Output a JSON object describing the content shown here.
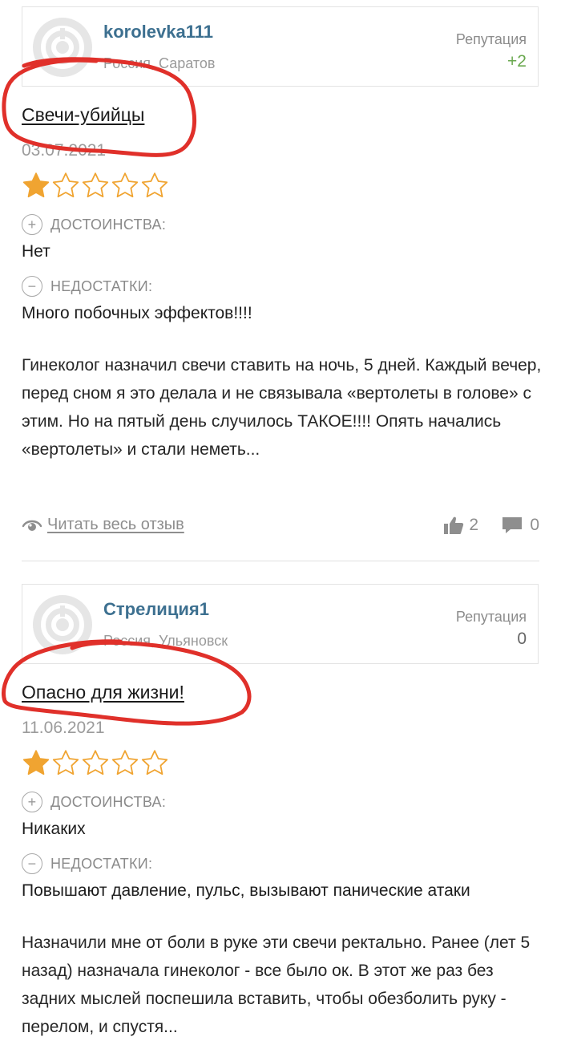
{
  "reviews": [
    {
      "author": {
        "name": "korolevka111",
        "location": "Россия, Саратов"
      },
      "reputation": {
        "label": "Репутация",
        "value": "+2",
        "color": "#6aa84f"
      },
      "title": "Свечи-убийцы",
      "date": "03.07.2021",
      "rating": 1,
      "pros": {
        "label": "ДОСТОИНСТВА:",
        "text": "Нет"
      },
      "cons": {
        "label": "НЕДОСТАТКИ:",
        "text": "Много побочных эффектов!!!!"
      },
      "body": "Гинеколог назначил свечи ставить на ночь, 5 дней. Каждый вечер, перед сном я это делала и не связывала «вертолеты в голове» с этим. Но на пятый день случилось ТАКОЕ!!!! Опять начались «вертолеты» и стали неметь...",
      "read_more": "Читать весь отзыв",
      "likes": "2",
      "comments": "0"
    },
    {
      "author": {
        "name": "Стрелиция1",
        "location": "Россия, Ульяновск"
      },
      "reputation": {
        "label": "Репутация",
        "value": "0",
        "color": "#666666"
      },
      "title": "Опасно для жизни!",
      "date": "11.06.2021",
      "rating": 1,
      "pros": {
        "label": "ДОСТОИНСТВА:",
        "text": "Никаких"
      },
      "cons": {
        "label": "НЕДОСТАТКИ:",
        "text": "Повышают давление, пульс, вызывают панические атаки"
      },
      "body": "Назначили мне от боли в руке эти свечи ректально. Ранее (лет 5 назад) назначала гинеколог - все было ок. В этот же раз без задних мыслей поспешила вставить, чтобы обезболить руку - перелом, и спустя..."
    }
  ],
  "colors": {
    "star": "#f0a431",
    "annotation": "#e0302a",
    "author": "#3d7090"
  }
}
